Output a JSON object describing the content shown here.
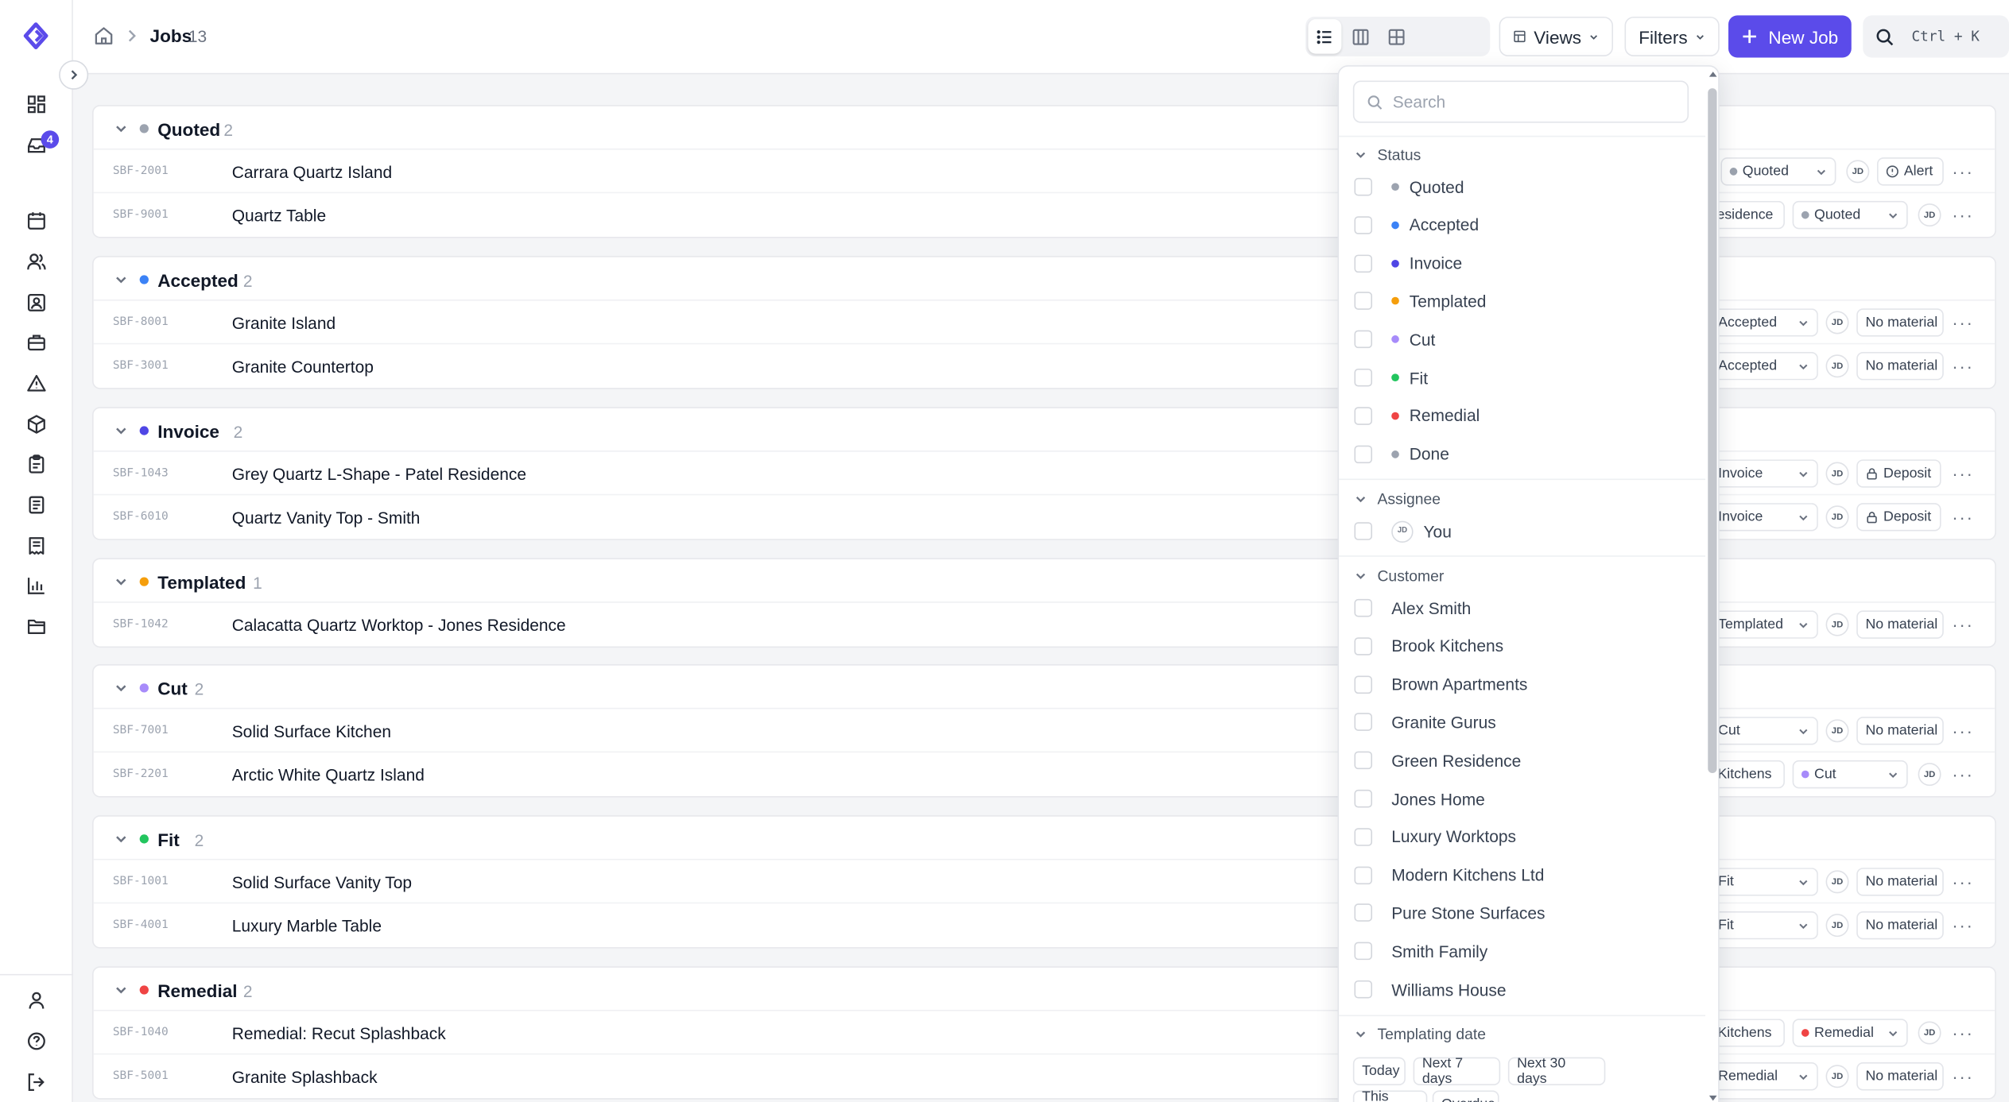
{
  "sidebar": {
    "inbox_badge": "4"
  },
  "header": {
    "title": "Jobs",
    "count": "13",
    "views_label": "Views",
    "filters_label": "Filters",
    "new_job_label": "New Job",
    "shortcut": "Ctrl + K"
  },
  "colors": {
    "accent": "#5b4bea",
    "quoted": "#9ca3af",
    "accepted": "#3b82f6",
    "invoice": "#4f46e5",
    "templated": "#f59e0b",
    "cut": "#a78bfa",
    "fit": "#22c55e",
    "remedial": "#ef4444",
    "done": "#9ca3af"
  },
  "groups": [
    {
      "name": "Quoted",
      "count": "2",
      "color": "#9ca3af",
      "rows": [
        {
          "id": "SBF-2001",
          "title": "Carrara Quartz Island",
          "status": "Quoted",
          "assignee": "JD",
          "tag": "Alert"
        },
        {
          "id": "SBF-9001",
          "title": "Quartz Table",
          "customer": "Residence",
          "status": "Quoted",
          "assignee": "JD"
        }
      ]
    },
    {
      "name": "Accepted",
      "count": "2",
      "color": "#3b82f6",
      "rows": [
        {
          "id": "SBF-8001",
          "title": "Granite Island",
          "status": "Accepted",
          "assignee": "JD",
          "tag": "No material"
        },
        {
          "id": "SBF-3001",
          "title": "Granite Countertop",
          "status": "Accepted",
          "assignee": "JD",
          "tag": "No material"
        }
      ]
    },
    {
      "name": "Invoice",
      "count": "2",
      "color": "#4f46e5",
      "rows": [
        {
          "id": "SBF-1043",
          "title": "Grey Quartz L-Shape - Patel Residence",
          "status": "Invoice",
          "assignee": "JD",
          "tag": "Deposit"
        },
        {
          "id": "SBF-6010",
          "title": "Quartz Vanity Top - Smith",
          "status": "Invoice",
          "assignee": "JD",
          "tag": "Deposit"
        }
      ]
    },
    {
      "name": "Templated",
      "count": "1",
      "color": "#f59e0b",
      "rows": [
        {
          "id": "SBF-1042",
          "title": "Calacatta Quartz Worktop - Jones Residence",
          "status": "Templated",
          "assignee": "JD",
          "tag": "No material"
        }
      ]
    },
    {
      "name": "Cut",
      "count": "2",
      "color": "#a78bfa",
      "rows": [
        {
          "id": "SBF-7001",
          "title": "Solid Surface Kitchen",
          "status": "Cut",
          "assignee": "JD",
          "tag": "No material"
        },
        {
          "id": "SBF-2201",
          "title": "Arctic White Quartz Island",
          "customer": "k Kitchens",
          "status": "Cut",
          "assignee": "JD"
        }
      ]
    },
    {
      "name": "Fit",
      "count": "2",
      "color": "#22c55e",
      "rows": [
        {
          "id": "SBF-1001",
          "title": "Solid Surface Vanity Top",
          "status": "Fit",
          "assignee": "JD",
          "tag": "No material"
        },
        {
          "id": "SBF-4001",
          "title": "Luxury Marble Table",
          "status": "Fit",
          "assignee": "JD",
          "tag": "No material"
        }
      ]
    },
    {
      "name": "Remedial",
      "count": "2",
      "color": "#ef4444",
      "rows": [
        {
          "id": "SBF-1040",
          "title": "Remedial: Recut Splashback",
          "customer": "k Kitchens",
          "status": "Remedial",
          "assignee": "JD"
        },
        {
          "id": "SBF-5001",
          "title": "Granite Splashback",
          "status": "Remedial",
          "assignee": "JD",
          "tag": "No material"
        }
      ]
    }
  ],
  "filter_menu": {
    "search_placeholder": "Search",
    "status_title": "Status",
    "statuses": [
      {
        "label": "Quoted",
        "color": "#9ca3af"
      },
      {
        "label": "Accepted",
        "color": "#3b82f6"
      },
      {
        "label": "Invoice",
        "color": "#4f46e5"
      },
      {
        "label": "Templated",
        "color": "#f59e0b"
      },
      {
        "label": "Cut",
        "color": "#a78bfa"
      },
      {
        "label": "Fit",
        "color": "#22c55e"
      },
      {
        "label": "Remedial",
        "color": "#ef4444"
      },
      {
        "label": "Done",
        "color": "#9ca3af"
      }
    ],
    "assignee_title": "Assignee",
    "assignee": {
      "initials": "JD",
      "label": "You"
    },
    "customer_title": "Customer",
    "customers": [
      "Alex Smith",
      "Brook Kitchens",
      "Brown Apartments",
      "Granite Gurus",
      "Green Residence",
      "Jones Home",
      "Luxury Worktops",
      "Modern Kitchens Ltd",
      "Pure Stone Surfaces",
      "Smith Family",
      "Williams House"
    ],
    "templating_title": "Templating date",
    "date_options": [
      "Today",
      "Next 7 days",
      "Next 30 days",
      "This week",
      "Overdue"
    ]
  }
}
